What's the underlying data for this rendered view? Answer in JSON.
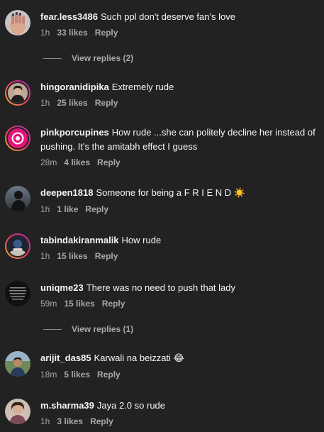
{
  "colors": {
    "background": "#222222",
    "text": "#f5f5f5",
    "meta": "#a8a8a8",
    "story_ring_start": "#f9b234",
    "story_ring_end": "#b02fb5"
  },
  "comments": [
    {
      "username": "fear.less3486",
      "text": "Such ppl don't deserve fan's love",
      "time": "1h",
      "likes": "33 likes",
      "reply": "Reply",
      "view_replies": "View replies (2)",
      "story_ring": false
    },
    {
      "username": "hingoranidipika",
      "text": "Extremely rude",
      "time": "1h",
      "likes": "25 likes",
      "reply": "Reply",
      "story_ring": true
    },
    {
      "username": "pinkporcupines",
      "text": "How rude ...she can politely decline her instead of pushing. It's the amitabh effect I guess",
      "time": "28m",
      "likes": "4 likes",
      "reply": "Reply",
      "story_ring": true
    },
    {
      "username": "deepen1818",
      "text": "Someone for being a F R I E N D",
      "emoji": "☀️",
      "time": "1h",
      "likes": "1 like",
      "reply": "Reply",
      "story_ring": false
    },
    {
      "username": "tabindakiranmalik",
      "text": "How rude",
      "time": "1h",
      "likes": "15 likes",
      "reply": "Reply",
      "story_ring": true
    },
    {
      "username": "uniqme23",
      "text": "There was no need to push that lady",
      "time": "59m",
      "likes": "15 likes",
      "reply": "Reply",
      "view_replies": "View replies (1)",
      "story_ring": false
    },
    {
      "username": "arijit_das85",
      "text": "Karwali na beizzati",
      "emoji": "😂",
      "time": "18m",
      "likes": "5 likes",
      "reply": "Reply",
      "story_ring": false
    },
    {
      "username": "m.sharma39",
      "text": "Jaya 2.0 so rude",
      "time": "1h",
      "likes": "3 likes",
      "reply": "Reply",
      "story_ring": false
    }
  ]
}
